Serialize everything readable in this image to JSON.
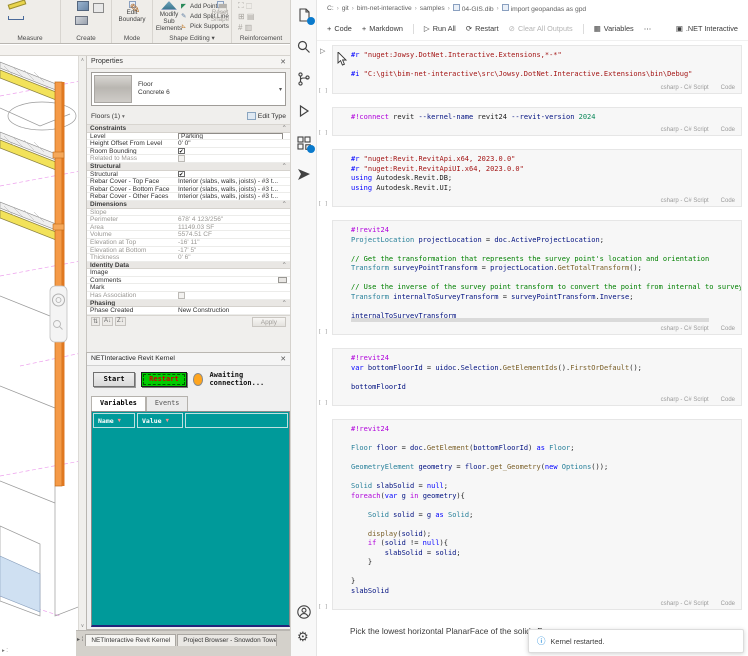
{
  "revit": {
    "ribbon": {
      "groups": {
        "measure": "Measure",
        "create": "Create",
        "mode": "Mode",
        "shape_editing": "Shape Editing ▾",
        "reinforcement": "Reinforcement"
      },
      "buttons": {
        "edit_boundary": "Edit Boundary",
        "modify_sub": "Modify Sub Elements",
        "reset_shape": "Reset Shape",
        "small": [
          "Add Point",
          "Add Split Line",
          "Pick Supports"
        ]
      }
    },
    "properties": {
      "title": "Properties",
      "close": "✕",
      "type_name": "Floor",
      "type_desc": "Concrete 6",
      "selector": "Floors (1)",
      "edit_type": "Edit Type",
      "apply": "Apply",
      "sections": [
        {
          "header": "Constraints",
          "rows": [
            {
              "label": "Level",
              "value": "Parking",
              "type": "input"
            },
            {
              "label": "Height Offset From Level",
              "value": "0'  0\""
            },
            {
              "label": "Room Bounding",
              "type": "check",
              "checked": true
            },
            {
              "label": "Related to Mass",
              "type": "check",
              "checked": false,
              "disabled": true
            }
          ]
        },
        {
          "header": "Structural",
          "rows": [
            {
              "label": "Structural",
              "type": "check",
              "checked": true
            },
            {
              "label": "Rebar Cover - Top Face",
              "value": "Interior (slabs, walls, joists) - #3 t..."
            },
            {
              "label": "Rebar Cover - Bottom Face",
              "value": "Interior (slabs, walls, joists) - #3 t..."
            },
            {
              "label": "Rebar Cover - Other Faces",
              "value": "Interior (slabs, walls, joists) - #3 t..."
            }
          ]
        },
        {
          "header": "Dimensions",
          "rows": [
            {
              "label": "Slope",
              "value": "",
              "disabled": true
            },
            {
              "label": "Perimeter",
              "value": "678'  4 123/256\"",
              "disabled": true
            },
            {
              "label": "Area",
              "value": "11149.03 SF",
              "disabled": true
            },
            {
              "label": "Volume",
              "value": "5574.51 CF",
              "disabled": true
            },
            {
              "label": "Elevation at Top",
              "value": "-16'  11\"",
              "disabled": true
            },
            {
              "label": "Elevation at Bottom",
              "value": "-17'  5\"",
              "disabled": true
            },
            {
              "label": "Thickness",
              "value": "0'  6\"",
              "disabled": true
            }
          ]
        },
        {
          "header": "Identity Data",
          "rows": [
            {
              "label": "Image",
              "value": ""
            },
            {
              "label": "Comments",
              "value": "",
              "type": "button"
            },
            {
              "label": "Mark",
              "value": ""
            },
            {
              "label": "Has Association",
              "type": "check",
              "checked": false,
              "disabled": true
            }
          ]
        },
        {
          "header": "Phasing",
          "rows": [
            {
              "label": "Phase Created",
              "value": "New Construction"
            }
          ]
        }
      ]
    },
    "kernel": {
      "title": "NETInteractive Revit Kernel",
      "close": "✕",
      "start_label": "Start",
      "restart_label": "Restart",
      "status": "Awaiting connection...",
      "tabs": [
        "Variables",
        "Events"
      ],
      "columns": [
        "Name",
        "Value"
      ]
    },
    "bottom_tabs": [
      "NETInteractive Revit Kernel",
      "Project Browser - Snowdon Towers..."
    ]
  },
  "vscode": {
    "breadcrumb": {
      "items": [
        {
          "label": "C:"
        },
        {
          "label": "git"
        },
        {
          "label": "bim-net-interactive"
        },
        {
          "label": "samples"
        },
        {
          "label": "04-GIS.dib",
          "icon": "notebook-file"
        },
        {
          "label": "import geopandas as gpd",
          "icon": "symbol-cell"
        }
      ]
    },
    "toolbar": {
      "items": [
        {
          "icon": "plus",
          "label": "Code"
        },
        {
          "icon": "plus",
          "label": "Markdown"
        },
        {
          "icon": "sep"
        },
        {
          "icon": "play",
          "label": "Run All"
        },
        {
          "icon": "restart",
          "label": "Restart"
        },
        {
          "icon": "clear",
          "label": "Clear All Outputs",
          "disabled": true
        },
        {
          "icon": "sep"
        },
        {
          "icon": "table",
          "label": "Variables"
        },
        {
          "icon": "more",
          "label": "⋯"
        }
      ],
      "right_label": ".NET Interactive"
    },
    "cells": [
      {
        "lang": "csharp - C# Script",
        "mode": "Code",
        "show_run": true,
        "lines": [
          [
            [
              "tk-d",
              "#r"
            ],
            [
              "tk-x",
              " "
            ],
            [
              "tk-s",
              "\"nuget:Jowsy.DotNet.Interactive.Extensions,*-*\""
            ]
          ],
          [],
          [
            [
              "tk-d",
              "#i"
            ],
            [
              "tk-x",
              " "
            ],
            [
              "tk-s",
              "\"C:\\git\\bim-net-interactive\\src\\Jowsy.DotNet.Interactive.Extensions\\bin\\Debug\""
            ]
          ]
        ]
      },
      {
        "lang": "csharp - C# Script",
        "mode": "Code",
        "lines": [
          [
            [
              "tk-m",
              "#!connect"
            ],
            [
              "tk-x",
              " revit "
            ],
            [
              "tk-p",
              "--kernel-name"
            ],
            [
              "tk-x",
              " revit24 "
            ],
            [
              "tk-p",
              "--revit-version"
            ],
            [
              "tk-x",
              " "
            ],
            [
              "tk-n",
              "2024"
            ]
          ]
        ]
      },
      {
        "lang": "csharp - C# Script",
        "mode": "Code",
        "lines": [
          [
            [
              "tk-d",
              "#r"
            ],
            [
              "tk-x",
              " "
            ],
            [
              "tk-s",
              "\"nuget:Revit.RevitApi.x64, 2023.0.0\""
            ]
          ],
          [
            [
              "tk-d",
              "#r"
            ],
            [
              "tk-x",
              " "
            ],
            [
              "tk-s",
              "\"nuget:Revit.RevitApiUI.x64, 2023.0.0\""
            ]
          ],
          [
            [
              "tk-k",
              "using"
            ],
            [
              "tk-x",
              " Autodesk.Revit.DB;"
            ]
          ],
          [
            [
              "tk-k",
              "using"
            ],
            [
              "tk-x",
              " Autodesk.Revit.UI;"
            ]
          ]
        ]
      },
      {
        "lang": "csharp - C# Script",
        "mode": "Code",
        "hscroll": true,
        "lines": [
          [
            [
              "tk-m",
              "#!revit24"
            ]
          ],
          [
            [
              "tk-t",
              "ProjectLocation"
            ],
            [
              "tk-x",
              " "
            ],
            [
              "tk-v",
              "projectLocation"
            ],
            [
              "tk-x",
              " = "
            ],
            [
              "tk-v",
              "doc"
            ],
            [
              "tk-x",
              "."
            ],
            [
              "tk-v",
              "ActiveProjectLocation"
            ],
            [
              "tk-x",
              ";"
            ]
          ],
          [],
          [
            [
              "tk-cm",
              "// Get the transformation that represents the survey point's location and orientation"
            ]
          ],
          [
            [
              "tk-t",
              "Transform"
            ],
            [
              "tk-x",
              " "
            ],
            [
              "tk-v",
              "surveyPointTransform"
            ],
            [
              "tk-x",
              " = "
            ],
            [
              "tk-v",
              "projectLocation"
            ],
            [
              "tk-x",
              "."
            ],
            [
              "tk-f",
              "GetTotalTransform"
            ],
            [
              "tk-x",
              "();"
            ]
          ],
          [],
          [
            [
              "tk-cm",
              "// Use the inverse of the survey point transform to convert the point from internal to survey coordinates"
            ]
          ],
          [
            [
              "tk-t",
              "Transform"
            ],
            [
              "tk-x",
              " "
            ],
            [
              "tk-v",
              "internalToSurveyTransform"
            ],
            [
              "tk-x",
              " = "
            ],
            [
              "tk-v",
              "surveyPointTransform"
            ],
            [
              "tk-x",
              "."
            ],
            [
              "tk-v",
              "Inverse"
            ],
            [
              "tk-x",
              ";"
            ]
          ],
          [],
          [
            [
              "tk-v",
              "internalToSurveyTransform"
            ]
          ]
        ]
      },
      {
        "lang": "csharp - C# Script",
        "mode": "Code",
        "lines": [
          [
            [
              "tk-m",
              "#!revit24"
            ]
          ],
          [
            [
              "tk-k",
              "var"
            ],
            [
              "tk-x",
              " "
            ],
            [
              "tk-v",
              "bottomFloorId"
            ],
            [
              "tk-x",
              " = "
            ],
            [
              "tk-v",
              "uidoc"
            ],
            [
              "tk-x",
              "."
            ],
            [
              "tk-v",
              "Selection"
            ],
            [
              "tk-x",
              "."
            ],
            [
              "tk-f",
              "GetElementIds"
            ],
            [
              "tk-x",
              "()."
            ],
            [
              "tk-f",
              "FirstOrDefault"
            ],
            [
              "tk-x",
              "();"
            ]
          ],
          [],
          [
            [
              "tk-v",
              "bottomFloorId"
            ]
          ]
        ]
      },
      {
        "lang": "csharp - C# Script",
        "mode": "Code",
        "lines": [
          [
            [
              "tk-m",
              "#!revit24"
            ]
          ],
          [],
          [
            [
              "tk-t",
              "Floor"
            ],
            [
              "tk-x",
              " "
            ],
            [
              "tk-v",
              "floor"
            ],
            [
              "tk-x",
              " = "
            ],
            [
              "tk-v",
              "doc"
            ],
            [
              "tk-x",
              "."
            ],
            [
              "tk-f",
              "GetElement"
            ],
            [
              "tk-x",
              "("
            ],
            [
              "tk-v",
              "bottomFloorId"
            ],
            [
              "tk-x",
              ") "
            ],
            [
              "tk-k",
              "as"
            ],
            [
              "tk-x",
              " "
            ],
            [
              "tk-t",
              "Floor"
            ],
            [
              "tk-x",
              ";"
            ]
          ],
          [],
          [
            [
              "tk-t",
              "GeometryElement"
            ],
            [
              "tk-x",
              " "
            ],
            [
              "tk-v",
              "geometry"
            ],
            [
              "tk-x",
              " = "
            ],
            [
              "tk-v",
              "floor"
            ],
            [
              "tk-x",
              "."
            ],
            [
              "tk-f",
              "get_Geometry"
            ],
            [
              "tk-x",
              "("
            ],
            [
              "tk-k",
              "new"
            ],
            [
              "tk-x",
              " "
            ],
            [
              "tk-t",
              "Options"
            ],
            [
              "tk-x",
              "());"
            ]
          ],
          [],
          [
            [
              "tk-t",
              "Solid"
            ],
            [
              "tk-x",
              " "
            ],
            [
              "tk-v",
              "slabSolid"
            ],
            [
              "tk-x",
              " = "
            ],
            [
              "tk-k",
              "null"
            ],
            [
              "tk-x",
              ";"
            ]
          ],
          [
            [
              "tk-c",
              "foreach"
            ],
            [
              "tk-x",
              "("
            ],
            [
              "tk-k",
              "var"
            ],
            [
              "tk-x",
              " "
            ],
            [
              "tk-v",
              "g"
            ],
            [
              "tk-x",
              " "
            ],
            [
              "tk-c",
              "in"
            ],
            [
              "tk-x",
              " "
            ],
            [
              "tk-v",
              "geometry"
            ],
            [
              "tk-x",
              "){"
            ]
          ],
          [],
          [
            [
              "tk-x",
              "    "
            ],
            [
              "tk-t",
              "Solid"
            ],
            [
              "tk-x",
              " "
            ],
            [
              "tk-v",
              "solid"
            ],
            [
              "tk-x",
              " = "
            ],
            [
              "tk-v",
              "g"
            ],
            [
              "tk-x",
              " "
            ],
            [
              "tk-k",
              "as"
            ],
            [
              "tk-x",
              " "
            ],
            [
              "tk-t",
              "Solid"
            ],
            [
              "tk-x",
              ";"
            ]
          ],
          [],
          [
            [
              "tk-x",
              "    "
            ],
            [
              "tk-f",
              "display"
            ],
            [
              "tk-x",
              "("
            ],
            [
              "tk-v",
              "solid"
            ],
            [
              "tk-x",
              ");"
            ]
          ],
          [
            [
              "tk-x",
              "    "
            ],
            [
              "tk-c",
              "if"
            ],
            [
              "tk-x",
              " ("
            ],
            [
              "tk-v",
              "solid"
            ],
            [
              "tk-x",
              " != "
            ],
            [
              "tk-k",
              "null"
            ],
            [
              "tk-x",
              "){"
            ]
          ],
          [
            [
              "tk-x",
              "        "
            ],
            [
              "tk-v",
              "slabSolid"
            ],
            [
              "tk-x",
              " = "
            ],
            [
              "tk-v",
              "solid"
            ],
            [
              "tk-x",
              ";"
            ]
          ],
          [
            [
              "tk-x",
              "    }"
            ]
          ],
          [],
          [
            [
              "tk-x",
              "}"
            ]
          ],
          [
            [
              "tk-v",
              "slabSolid"
            ]
          ]
        ]
      }
    ],
    "markdown_text": "Pick the lowest horizontal PlanarFace of the solids Fa",
    "toast": {
      "text": "Kernel restarted."
    }
  }
}
